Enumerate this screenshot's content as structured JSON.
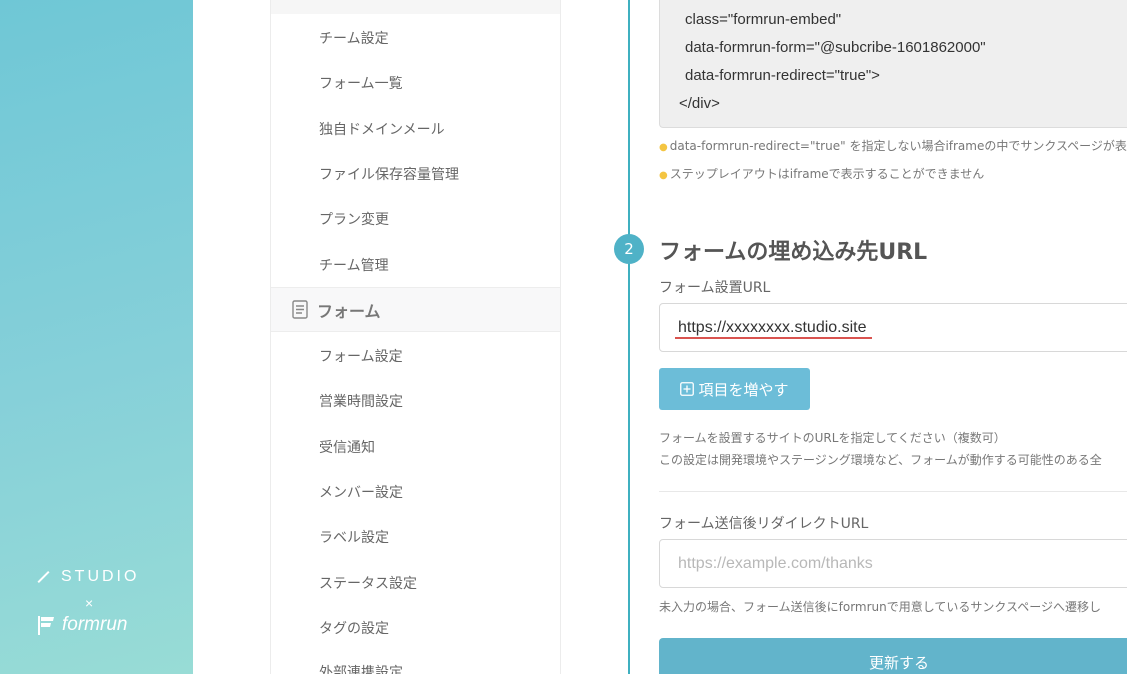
{
  "brand": {
    "studio": "STUDIO",
    "times": "×",
    "formrun": "formrun"
  },
  "nav": {
    "items_top": [
      "チーム設定",
      "フォーム一覧",
      "独自ドメインメール",
      "ファイル保存容量管理",
      "プラン変更",
      "チーム管理"
    ],
    "section": "フォーム",
    "items_form": [
      "フォーム設定",
      "営業時間設定",
      "受信通知",
      "メンバー設定",
      "ラベル設定",
      "ステータス設定",
      "タグの設定",
      "外部連携設定"
    ]
  },
  "code": {
    "lines": [
      "class=\"formrun-embed\"",
      "data-formrun-form=\"@subcribe-1601862000\"",
      "data-formrun-redirect=\"true\">",
      "</div>"
    ]
  },
  "hints": [
    "data-formrun-redirect=\"true\" を指定しない場合iframeの中でサンクスページが表",
    "ステップレイアウトはiframeで表示することができません"
  ],
  "step": {
    "number": "2",
    "title": "フォームの埋め込み先URL"
  },
  "embed_url": {
    "label": "フォーム設置URL",
    "value": "https://xxxxxxxx.studio.site"
  },
  "add_button": "項目を増やす",
  "descriptions": [
    "フォームを設置するサイトのURLを指定してください（複数可）",
    "この設定は開発環境やステージング環境など、フォームが動作する可能性のある全"
  ],
  "redirect": {
    "label": "フォーム送信後リダイレクトURL",
    "placeholder": "https://example.com/thanks",
    "note": "未入力の場合、フォーム送信後にformrunで用意しているサンクスページへ遷移し"
  },
  "submit": "更新する"
}
